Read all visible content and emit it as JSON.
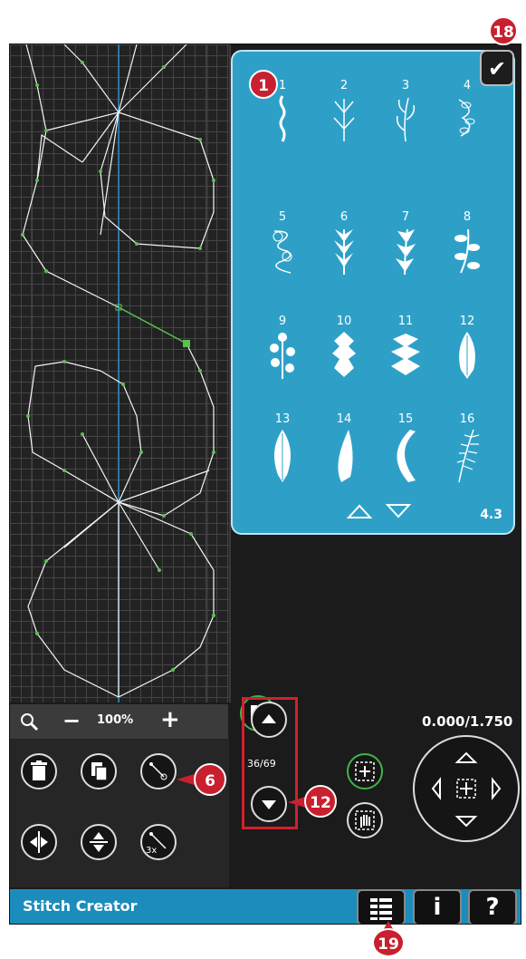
{
  "panel": {
    "badge": "1",
    "stitches": [
      {
        "num": "1"
      },
      {
        "num": "2"
      },
      {
        "num": "3"
      },
      {
        "num": "4"
      },
      {
        "num": "5"
      },
      {
        "num": "6"
      },
      {
        "num": "7"
      },
      {
        "num": "8"
      },
      {
        "num": "9"
      },
      {
        "num": "10"
      },
      {
        "num": "11"
      },
      {
        "num": "12"
      },
      {
        "num": "13"
      },
      {
        "num": "14"
      },
      {
        "num": "15"
      },
      {
        "num": "16"
      }
    ],
    "page_indicator": "4.3"
  },
  "ok_button": {
    "label": "✔",
    "badge": "18"
  },
  "toolbar": {
    "zoom_value": "100%"
  },
  "callouts": {
    "six": "6",
    "twelve": "12",
    "nineteen": "19"
  },
  "stitch_counter": "36/69",
  "coordinates": "0.000/1.750",
  "footer": {
    "title": "Stitch Creator",
    "info": "i",
    "help": "?"
  },
  "colors": {
    "accent": "#2ea0c8",
    "footer": "#1c8cbc",
    "badge": "#c8202e",
    "green": "#3fb54a"
  }
}
